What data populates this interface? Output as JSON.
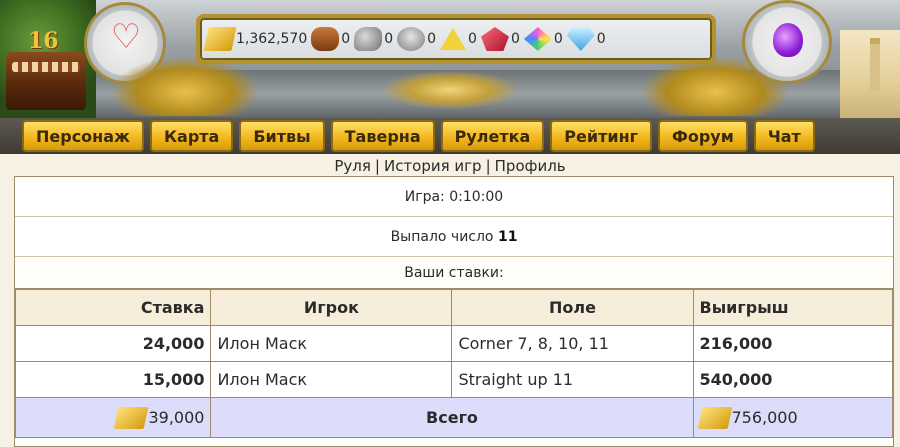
{
  "header": {
    "cake_number": "16",
    "resources": [
      {
        "icon": "gold-bars-icon",
        "value": "1,362,570"
      },
      {
        "icon": "wood-logs-icon",
        "value": "0"
      },
      {
        "icon": "stone-icon",
        "value": "0"
      },
      {
        "icon": "iron-pot-icon",
        "value": "0"
      },
      {
        "icon": "sulfur-icon",
        "value": "0"
      },
      {
        "icon": "crystal-icon",
        "value": "0"
      },
      {
        "icon": "gems-icon",
        "value": "0"
      },
      {
        "icon": "diamond-icon",
        "value": "0"
      }
    ]
  },
  "nav": {
    "items": [
      "Персонаж",
      "Карта",
      "Битвы",
      "Таверна",
      "Рулетка",
      "Рейтинг",
      "Форум",
      "Чат"
    ]
  },
  "sublinks": [
    "Руля",
    "История игр",
    "Профиль"
  ],
  "game": {
    "label": "Игра:",
    "time": "0:10:00",
    "drop_label": "Выпало число",
    "drop_number": "11",
    "bets_caption": "Ваши ставки:"
  },
  "bets_table": {
    "headers": [
      "Ставка",
      "Игрок",
      "Поле",
      "Выигрыш"
    ],
    "rows": [
      {
        "stake": "24,000",
        "player": "Илон Маск",
        "field": "Corner 7, 8, 10, 11",
        "win": "216,000"
      },
      {
        "stake": "15,000",
        "player": "Илон Маск",
        "field": "Straight up 11",
        "win": "540,000"
      }
    ],
    "total": {
      "stake": "39,000",
      "label": "Всего",
      "win": "756,000"
    }
  }
}
